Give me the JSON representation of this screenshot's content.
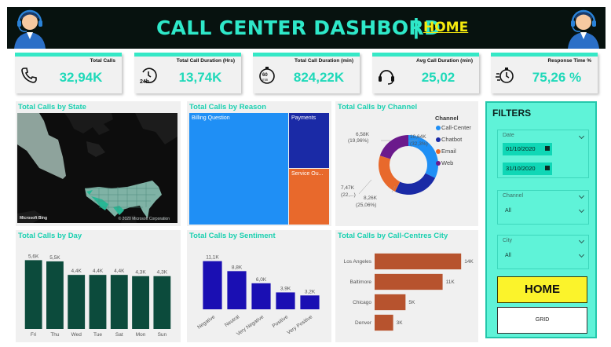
{
  "header": {
    "title": "CALL CENTER DASHBORD",
    "separator": "|",
    "home_link": "HOME"
  },
  "kpis": [
    {
      "label": "Total Calls",
      "value": "32,94K",
      "icon": "phone-icon"
    },
    {
      "label": "Total Call Duration (Hrs)",
      "value": "13,74K",
      "icon": "24h-clock-icon"
    },
    {
      "label": "Total Call Duration (min)",
      "value": "824,22K",
      "icon": "60min-timer-icon"
    },
    {
      "label": "Avg Call Duration (min)",
      "value": "25,02",
      "icon": "headset-icon"
    },
    {
      "label": "Response Time %",
      "value": "75,26 %",
      "icon": "fast-timer-icon"
    }
  ],
  "state_panel": {
    "title": "Total Calls by State",
    "map_credit": "© 2020 Microsoft Corporation",
    "map_brand": "Microsoft Bing"
  },
  "reason_panel": {
    "title": "Total Calls by Reason",
    "tiles": [
      "Billing Question",
      "Payments",
      "Service Ou..."
    ]
  },
  "channel_panel": {
    "title": "Total Calls by Channel",
    "legend_title": "Channel",
    "labels": {
      "top_left_value": "6,58K",
      "top_left_pct": "(19,96%)",
      "top_right_value": "10,64K",
      "top_right_pct": "(32,3%)",
      "left_value": "7,47K",
      "left_pct": "(22,...)",
      "bottom_value": "8,26K",
      "bottom_pct": "(25,06%)"
    }
  },
  "day_panel": {
    "title": "Total Calls by Day"
  },
  "sentiment_panel": {
    "title": "Total Calls by Sentiment"
  },
  "city_panel": {
    "title": "Total Calls by Call-Centres City"
  },
  "filters": {
    "title": "FILTERS",
    "date": {
      "label": "Date",
      "from": "01/10/2020",
      "to": "31/10/2020"
    },
    "channel": {
      "label": "Channel",
      "value": "All"
    },
    "city": {
      "label": "City",
      "value": "All"
    },
    "home_button": "HOME",
    "grid_button": "GRID"
  },
  "colors": {
    "accent": "#1fd9b9",
    "header_bg": "#07120f",
    "home_yellow": "#fbf32b"
  },
  "chart_data": [
    {
      "type": "treemap",
      "title": "Total Calls by Reason",
      "categories": [
        "Billing Question",
        "Payments",
        "Service Ou..."
      ],
      "colors": [
        "#1f8ff5",
        "#1a2aa6",
        "#e8692c"
      ]
    },
    {
      "type": "donut",
      "title": "Total Calls by Channel",
      "categories": [
        "Call-Center",
        "Chatbot",
        "Email",
        "Web"
      ],
      "values": [
        10.64,
        8.26,
        7.47,
        6.58
      ],
      "unit": "K",
      "colors": [
        "#1f8ff5",
        "#1a2aa6",
        "#e8692c",
        "#6b1a8c"
      ]
    },
    {
      "type": "bar",
      "title": "Total Calls by Day",
      "categories": [
        "Fri",
        "Thu",
        "Wed",
        "Tue",
        "Sat",
        "Mon",
        "Sun"
      ],
      "values": [
        5.6,
        5.5,
        4.4,
        4.4,
        4.4,
        4.3,
        4.3
      ],
      "labels": [
        "5,6K",
        "5,5K",
        "4,4K",
        "4,4K",
        "4,4K",
        "4,3K",
        "4,3K"
      ],
      "ylim": [
        0,
        6.2
      ],
      "color": "#0c4b3c"
    },
    {
      "type": "bar",
      "title": "Total Calls by Sentiment",
      "categories": [
        "Negative",
        "Neutral",
        "Very Negative",
        "Positive",
        "Very Positive"
      ],
      "values": [
        11.1,
        8.8,
        6.0,
        3.9,
        3.2
      ],
      "labels": [
        "11,1K",
        "8,8K",
        "6,0K",
        "3,9K",
        "3,2K"
      ],
      "ylim": [
        0,
        12.3
      ],
      "color": "#1a0fb3"
    },
    {
      "type": "bar",
      "orientation": "horizontal",
      "title": "Total Calls by Call-Centres City",
      "categories": [
        "Los Angeles",
        "Baltimore",
        "Chicago",
        "Denver"
      ],
      "values": [
        14,
        11,
        5,
        3
      ],
      "labels": [
        "14K",
        "11K",
        "5K",
        "3K"
      ],
      "xlim": [
        0,
        15.5
      ],
      "color": "#b7532e"
    }
  ]
}
